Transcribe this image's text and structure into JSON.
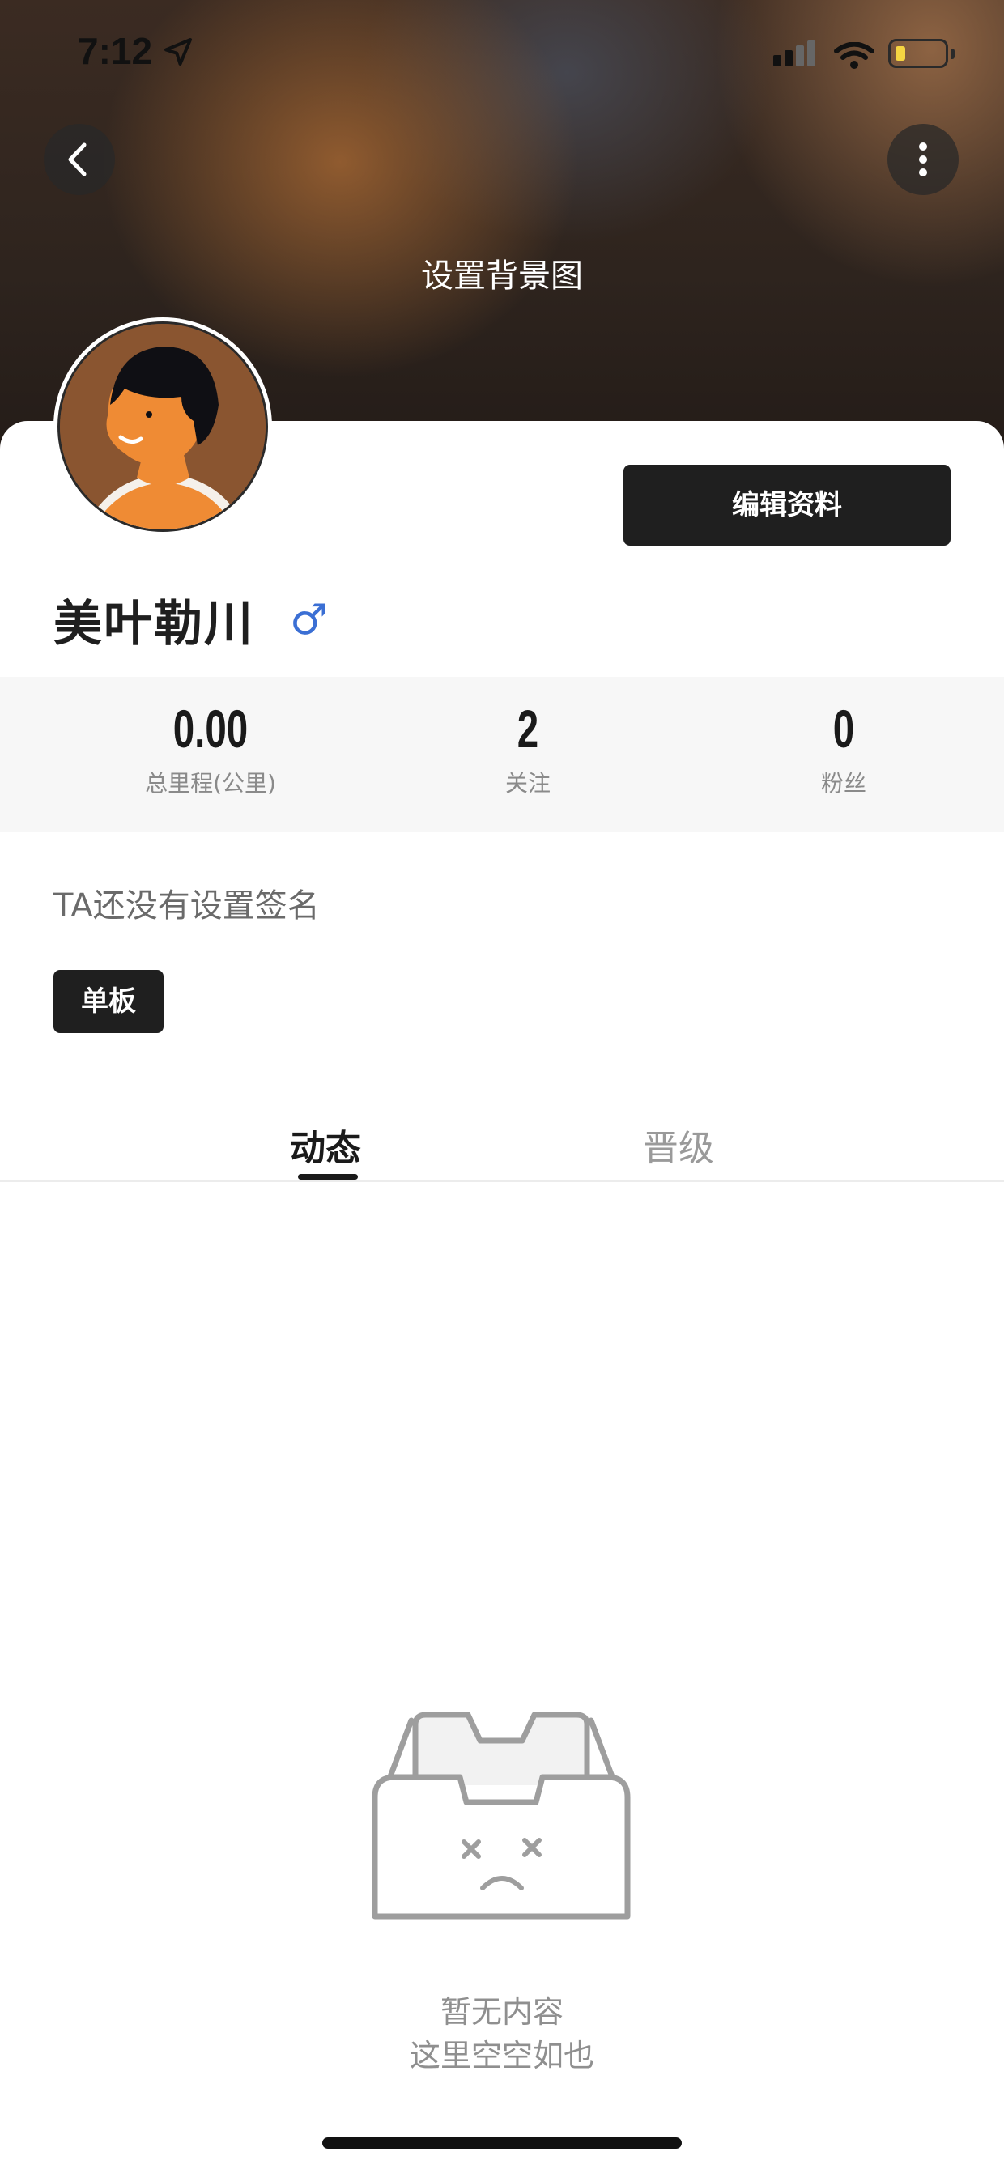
{
  "status_bar": {
    "time": "7:12"
  },
  "header": {
    "set_background_label": "设置背景图"
  },
  "profile": {
    "edit_button": "编辑资料",
    "username": "美叶勒川",
    "gender_symbol": "♂",
    "signature": "TA还没有设置签名",
    "tag": "单板"
  },
  "stats": [
    {
      "value": "0.00",
      "label": "总里程(公里)"
    },
    {
      "value": "2",
      "label": "关注"
    },
    {
      "value": "0",
      "label": "粉丝"
    }
  ],
  "tabs": [
    {
      "label": "动态",
      "active": true
    },
    {
      "label": "晋级",
      "active": false
    }
  ],
  "empty_state": {
    "title": "暂无内容",
    "subtitle": "这里空空如也"
  },
  "colors": {
    "accent_dark": "#1f1f1f",
    "gender_male": "#3b6fd4"
  }
}
